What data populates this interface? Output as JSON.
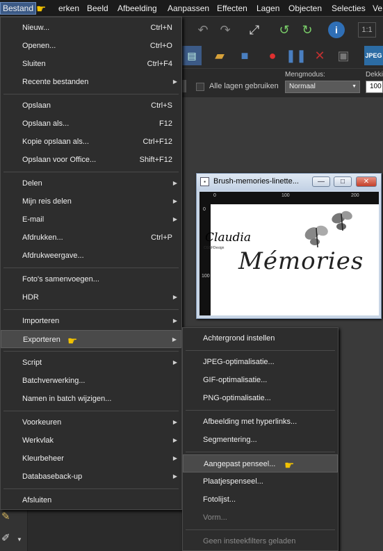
{
  "menubar": {
    "items": [
      "Bestand",
      "Bewerken",
      "Beeld",
      "Afbeelding",
      "Aanpassen",
      "Effecten",
      "Lagen",
      "Objecten",
      "Selecties",
      "Ve"
    ],
    "visible_bewerken": "erken"
  },
  "file_menu": {
    "items": [
      {
        "label": "Nieuw...",
        "shortcut": "Ctrl+N"
      },
      {
        "label": "Openen...",
        "shortcut": "Ctrl+O"
      },
      {
        "label": "Sluiten",
        "shortcut": "Ctrl+F4"
      },
      {
        "label": "Recente bestanden",
        "submenu": true
      },
      {
        "label": "Opslaan",
        "shortcut": "Ctrl+S"
      },
      {
        "label": "Opslaan als...",
        "shortcut": "F12"
      },
      {
        "label": "Kopie opslaan als...",
        "shortcut": "Ctrl+F12"
      },
      {
        "label": "Opslaan voor Office...",
        "shortcut": "Shift+F12"
      },
      {
        "label": "Delen",
        "submenu": true
      },
      {
        "label": "Mijn reis delen",
        "submenu": true
      },
      {
        "label": "E-mail",
        "submenu": true
      },
      {
        "label": "Afdrukken...",
        "shortcut": "Ctrl+P"
      },
      {
        "label": "Afdrukweergave..."
      },
      {
        "label": "Foto's samenvoegen..."
      },
      {
        "label": "HDR",
        "submenu": true
      },
      {
        "label": "Importeren",
        "submenu": true
      },
      {
        "label": "Exporteren",
        "submenu": true
      },
      {
        "label": "Script",
        "submenu": true
      },
      {
        "label": "Batchverwerking..."
      },
      {
        "label": "Namen in batch wijzigen..."
      },
      {
        "label": "Voorkeuren",
        "submenu": true
      },
      {
        "label": "Werkvlak",
        "submenu": true
      },
      {
        "label": "Kleurbeheer",
        "submenu": true
      },
      {
        "label": "Databaseback-up",
        "submenu": true
      },
      {
        "label": "Afsluiten"
      }
    ]
  },
  "export_submenu": {
    "items": [
      "Achtergrond instellen",
      "JPEG-optimalisatie...",
      "GIF-optimalisatie...",
      "PNG-optimalisatie...",
      "Afbeelding met hyperlinks...",
      "Segmentering...",
      "Aangepast penseel...",
      "Plaatjespenseel...",
      "Fotolijst...",
      "Vorm...",
      "Geen insteekfilters geladen"
    ]
  },
  "options": {
    "use_all_layers": "Alle lagen gebruiken",
    "blend_mode_label": "Mengmodus:",
    "blend_mode_value": "Normaal",
    "opacity_label": "Dekking",
    "opacity_value": "100"
  },
  "image_window": {
    "title": "Brush-memories-linette...",
    "ruler_top_labels": [
      "0",
      "100",
      "200"
    ],
    "ruler_left_labels": [
      "0",
      "100"
    ],
    "watermark": "Claudia",
    "watermark_sub": "CGSFDesign",
    "artwork_text": "Mémories"
  },
  "toolbar": {
    "jpeg_label": "JPEG"
  },
  "colors": {
    "menu_bg": "#2d2d2d",
    "highlight": "#4a4a4a",
    "pointer": "#f2c200"
  }
}
